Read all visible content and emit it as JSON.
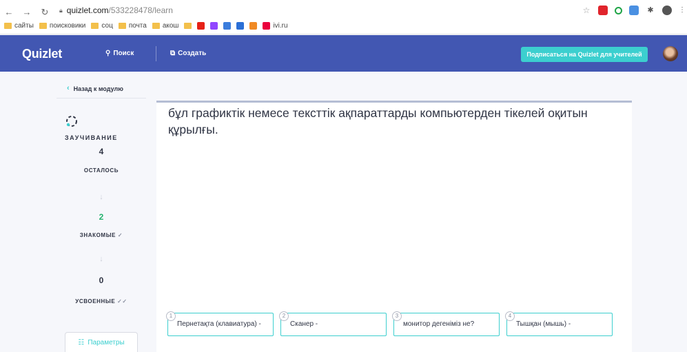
{
  "browser": {
    "url_host": "quizlet.com",
    "url_path": "/533228478/learn",
    "bookmarks": [
      "сайты",
      "поисковики",
      "соц",
      "почта",
      "акош",
      "ivi.ru"
    ]
  },
  "header": {
    "logo": "Quizlet",
    "search_label": "Поиск",
    "create_label": "Создать",
    "teacher_button": "Подписаться на Quizlet для учителей"
  },
  "sidebar": {
    "back_label": "Назад к модулю",
    "mode_label": "ЗАУЧИВАНИЕ",
    "remaining_count": "4",
    "remaining_label": "ОСТАЛОСЬ",
    "familiar_count": "2",
    "familiar_label": "ЗНАКОМЫЕ",
    "mastered_count": "0",
    "mastered_label": "УСВОЕННЫЕ",
    "params_label": "Параметры"
  },
  "question": {
    "text": "бұл графиктік немесе тексттік ақпараттарды компьютерден тікелей оқитын құрылғы."
  },
  "options": [
    {
      "num": "1",
      "label": "Пернетақта (клавиатура) -"
    },
    {
      "num": "2",
      "label": "Сканер -"
    },
    {
      "num": "3",
      "label": "монитор дегеніміз не?"
    },
    {
      "num": "4",
      "label": "Тышқан (мышь) -"
    }
  ],
  "colors": {
    "header_bg": "#4257b2",
    "accent": "#3ccfcf",
    "familiar": "#23b26d"
  }
}
